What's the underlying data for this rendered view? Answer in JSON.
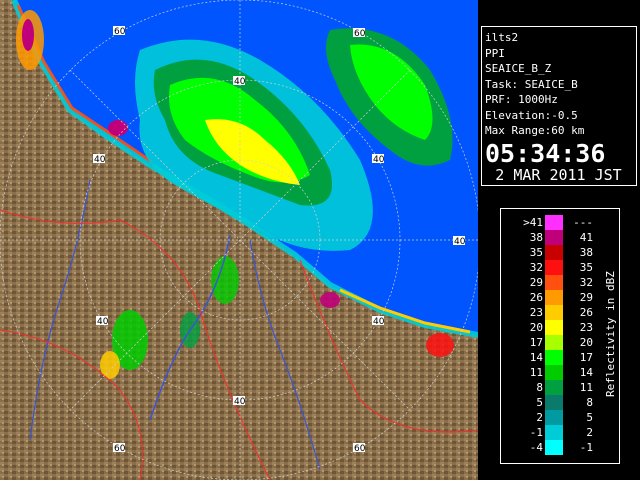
{
  "info": {
    "site": "ilts2",
    "scan_type": "PPI",
    "product": "SEAICE_B_Z",
    "task": "Task: SEAICE_B",
    "prf": "PRF: 1000Hz",
    "elevation": "Elevation:-0.5",
    "max_range": "Max Range:60 km",
    "time": "05:34:36",
    "date": "2 MAR 2011 JST"
  },
  "legend": {
    "unit": "Reflectivity in dBZ",
    "rows": [
      {
        "lo": ">41",
        "hi": "---",
        "color": "#ff30ff"
      },
      {
        "lo": "38",
        "hi": "41",
        "color": "#c0007a"
      },
      {
        "lo": "35",
        "hi": "38",
        "color": "#c80000"
      },
      {
        "lo": "32",
        "hi": "35",
        "color": "#ff1010"
      },
      {
        "lo": "29",
        "hi": "32",
        "color": "#ff5010"
      },
      {
        "lo": "26",
        "hi": "29",
        "color": "#ff9a00"
      },
      {
        "lo": "23",
        "hi": "26",
        "color": "#ffcc00"
      },
      {
        "lo": "20",
        "hi": "23",
        "color": "#ffff00"
      },
      {
        "lo": "17",
        "hi": "20",
        "color": "#a8ff00"
      },
      {
        "lo": "14",
        "hi": "17",
        "color": "#00ff00"
      },
      {
        "lo": "11",
        "hi": "14",
        "color": "#00cc00"
      },
      {
        "lo": "8",
        "hi": "11",
        "color": "#00a040"
      },
      {
        "lo": "5",
        "hi": "8",
        "color": "#0a7a6a"
      },
      {
        "lo": "2",
        "hi": "5",
        "color": "#009aa0"
      },
      {
        "lo": "-1",
        "hi": "2",
        "color": "#00ccd8"
      },
      {
        "lo": "-4",
        "hi": "-1",
        "color": "#00ffff"
      }
    ]
  },
  "range_labels": [
    "60",
    "40",
    "40",
    "40",
    "60",
    "40",
    "40",
    "40",
    "40",
    "60",
    "60"
  ],
  "colors": {
    "sea": "#0055ff",
    "land": "#8a6f4a",
    "border": "#ff2a2a",
    "river": "#3b55d8",
    "ring": "#d0d0d0"
  }
}
